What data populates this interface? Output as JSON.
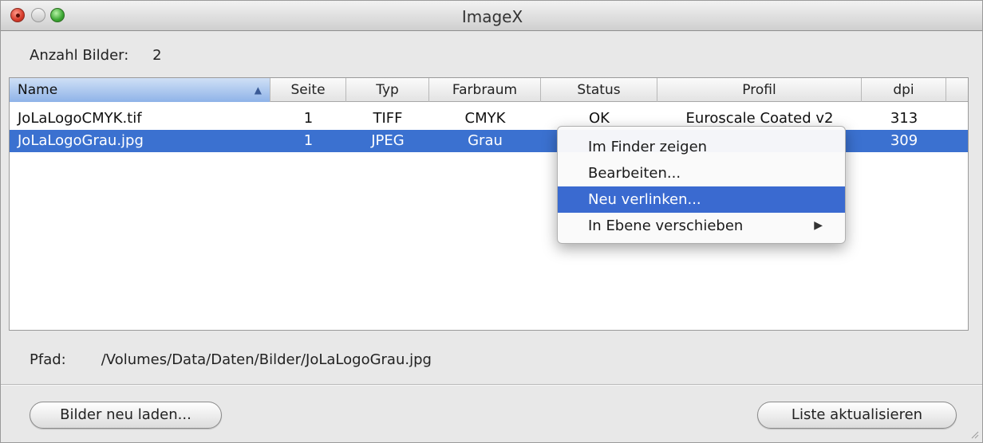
{
  "window": {
    "title": "ImageX"
  },
  "count": {
    "label": "Anzahl Bilder:",
    "value": "2"
  },
  "table": {
    "columns": [
      "Name",
      "Seite",
      "Typ",
      "Farbraum",
      "Status",
      "Profil",
      "dpi"
    ],
    "sort_indicator": "▲",
    "rows": [
      {
        "name": "JoLaLogoCMYK.tif",
        "seite": "1",
        "typ": "TIFF",
        "farbraum": "CMYK",
        "status": "OK",
        "profil": "Euroscale Coated v2",
        "dpi": "313",
        "selected": false
      },
      {
        "name": "JoLaLogoGrau.jpg",
        "seite": "1",
        "typ": "JPEG",
        "farbraum": "Grau",
        "status": "",
        "profil": "",
        "dpi": "309",
        "selected": true
      }
    ]
  },
  "path": {
    "label": "Pfad:",
    "value": "/Volumes/Data/Daten/Bilder/JoLaLogoGrau.jpg"
  },
  "buttons": {
    "reload": "Bilder neu laden...",
    "refresh": "Liste aktualisieren"
  },
  "context_menu": {
    "items": [
      {
        "label": "Im Finder zeigen"
      },
      {
        "label": "Bearbeiten..."
      },
      {
        "label": "Neu verlinken..."
      },
      {
        "label": "In Ebene verschieben"
      }
    ],
    "submenu_arrow": "▶"
  },
  "colors": {
    "selection": "#3b71d0",
    "menu_highlight": "#3a6ad0"
  }
}
